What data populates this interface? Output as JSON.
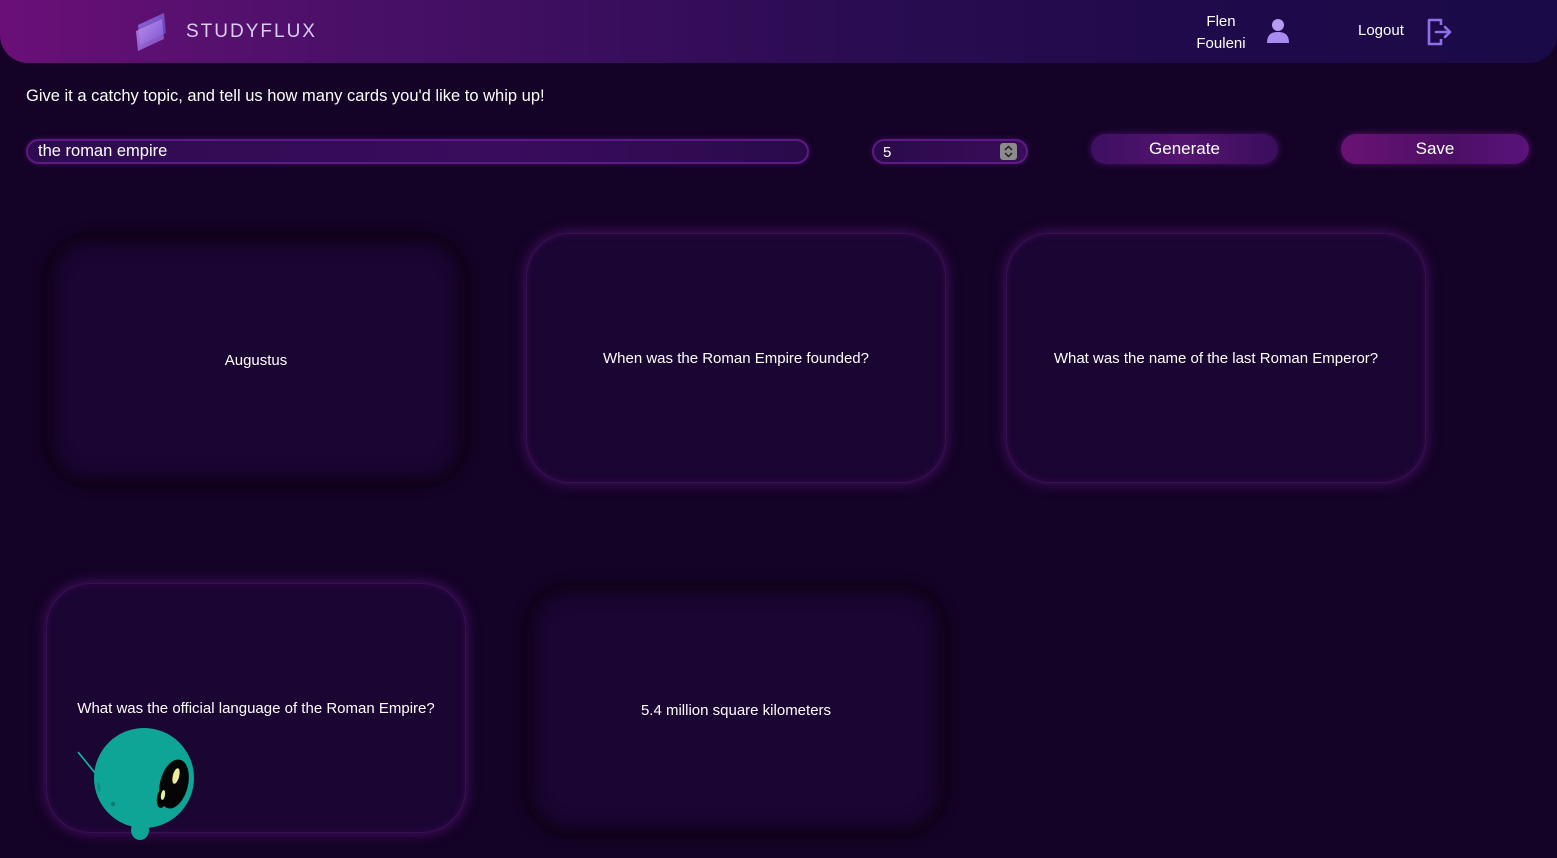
{
  "header": {
    "brand": "STUDYFLUX",
    "user": {
      "first_name": "Flen",
      "last_name": "Fouleni"
    },
    "logout_label": "Logout",
    "icons": {
      "logo": "layers-logo-icon",
      "user": "user-icon",
      "logout": "logout-icon"
    }
  },
  "form": {
    "prompt": "Give it a catchy topic, and tell us how many cards you'd like to whip up!",
    "topic_value": "the roman empire",
    "count_value": "5",
    "generate_label": "Generate",
    "save_label": "Save"
  },
  "cards": [
    {
      "text": "Augustus"
    },
    {
      "text": "When was the Roman Empire founded?"
    },
    {
      "text": "What was the name of the last Roman Emperor?"
    },
    {
      "text": "What was the official language of the Roman Empire?"
    },
    {
      "text": "5.4 million square kilometers"
    }
  ],
  "colors": {
    "background": "#140326",
    "accent": "#6b0f78",
    "card": "#1b0533",
    "mascot": "#0fa596"
  }
}
